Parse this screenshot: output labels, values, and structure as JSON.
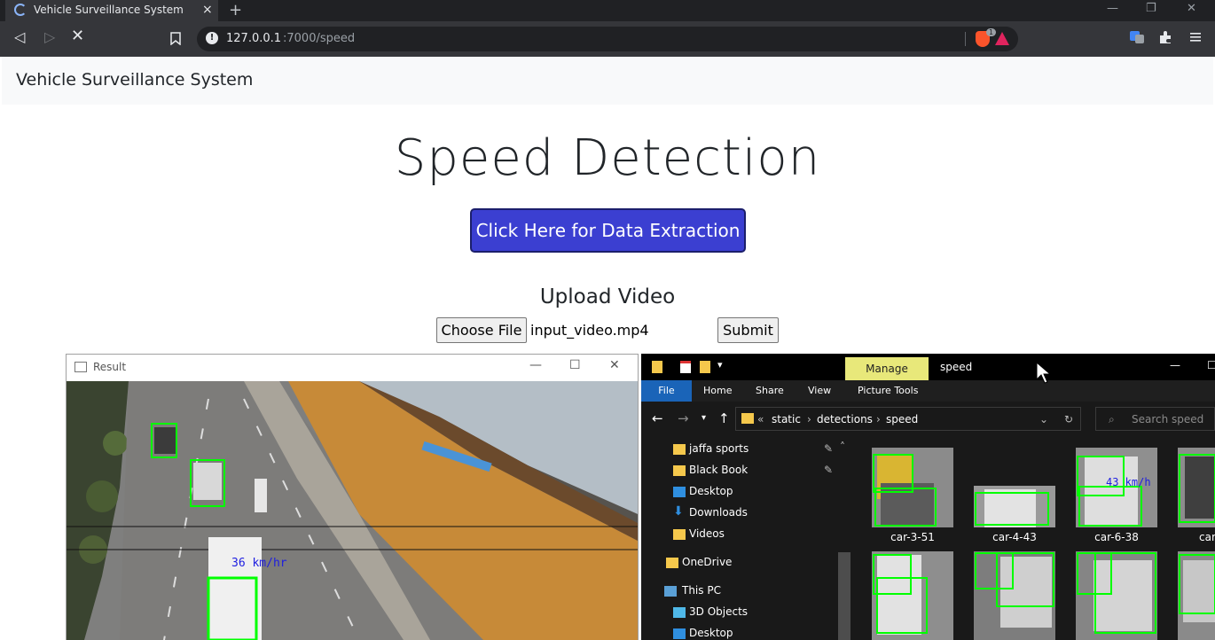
{
  "browser": {
    "tab_title": "Vehicle Surveillance System",
    "tab_close": "×",
    "new_tab": "+",
    "url_host": "127.0.0.1",
    "url_path": ":7000/speed",
    "brave_badge": "1",
    "icons": [
      "back-icon",
      "forward-icon",
      "stop-icon",
      "bookmark-icon",
      "site-info-icon",
      "brave-shields-icon",
      "brave-rewards-icon",
      "translate-icon",
      "extensions-icon",
      "menu-icon"
    ]
  },
  "page": {
    "brand": "Vehicle Surveillance System",
    "heading": "Speed Detection",
    "cta_label": "Click Here for Data Extraction",
    "upload_title": "Upload Video",
    "choose_file_label": "Choose File",
    "file_name": "input_video.mp4",
    "submit_label": "Submit",
    "colors": {
      "cta": "#3b3fd1",
      "navbar": "#f8f9fa"
    }
  },
  "result_window": {
    "title": "Result",
    "speed_label": "36 km/hr"
  },
  "explorer": {
    "manage": "Manage",
    "title": "speed",
    "ribbon": {
      "file": "File",
      "home": "Home",
      "share": "Share",
      "view": "View",
      "picture_tools": "Picture Tools"
    },
    "breadcrumb": {
      "chevrons": "«",
      "items": [
        "static",
        "detections",
        "speed"
      ]
    },
    "search_placeholder": "Search speed",
    "nav": [
      "jaffa sports",
      "Black Book",
      "Desktop",
      "Downloads",
      "Videos",
      "OneDrive",
      "This PC",
      "3D Objects",
      "Desktop"
    ],
    "thumbnails": [
      "car-3-51",
      "car-4-43",
      "car-6-38",
      "car"
    ],
    "thumb_speed_label": "43 km/h"
  }
}
